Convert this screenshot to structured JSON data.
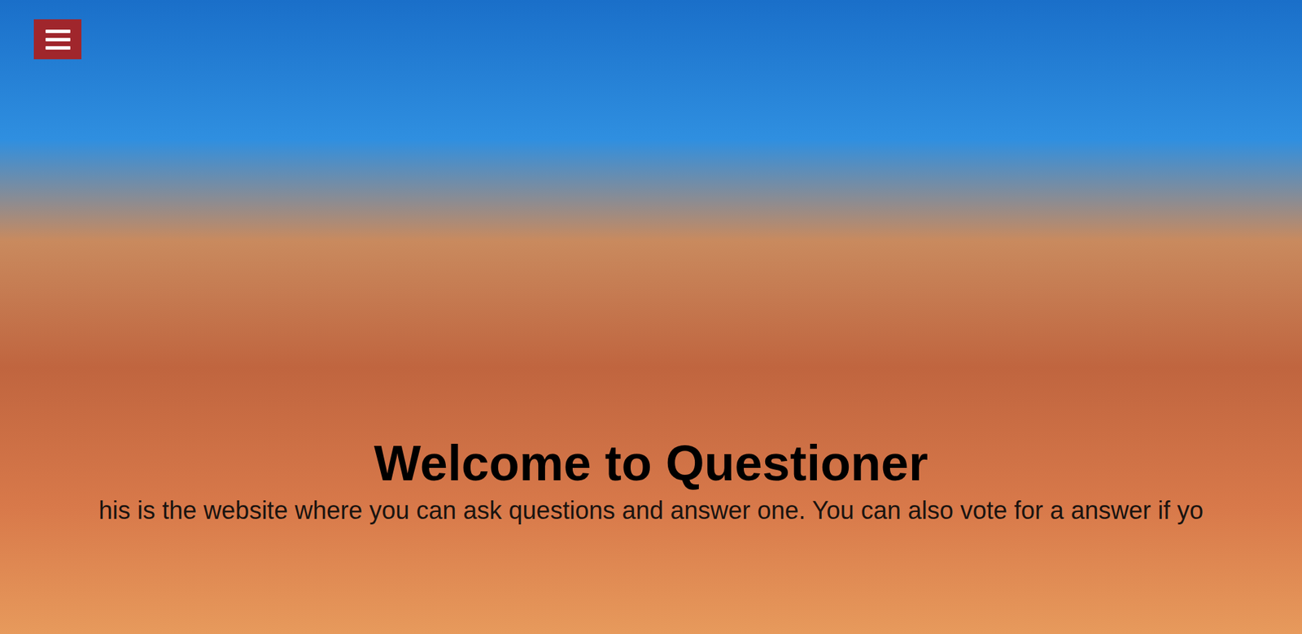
{
  "hero": {
    "title": "Welcome to Questioner",
    "subtitle": "his is the website where you can ask questions and answer one. You can also vote for a answer if yo"
  }
}
